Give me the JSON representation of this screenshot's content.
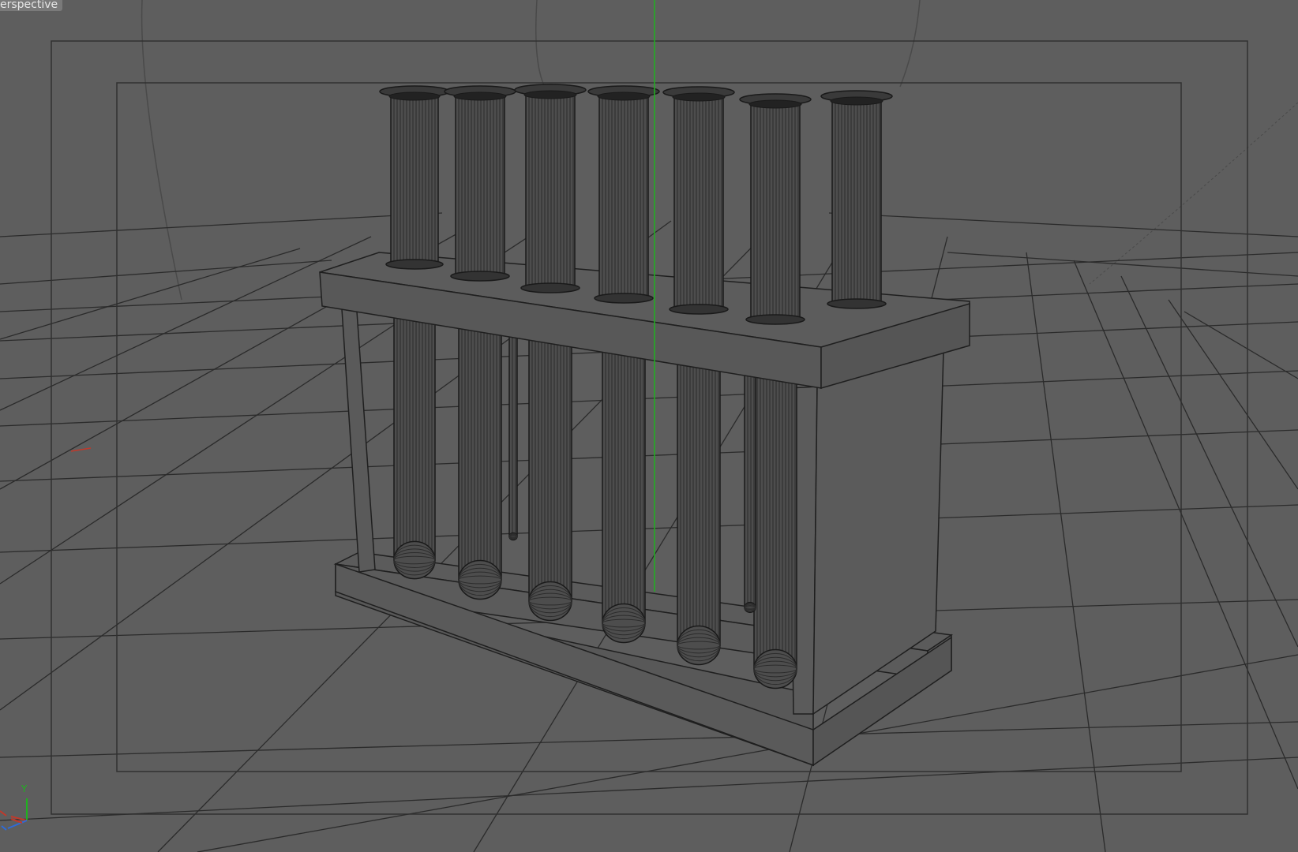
{
  "viewport": {
    "view_name": "erspective",
    "colors": {
      "background": "#5e5e5e",
      "grid": "#2a2a2a",
      "wire": "#1f1f1f",
      "tube_fill": "#4a4a4a",
      "rack_fill": "#5b5b5b",
      "y_axis": "#1fb21f",
      "x_axis": "#c0392b",
      "z_axis": "#2f6bd8"
    }
  },
  "axis_gizmo": {
    "y_label": "Y"
  },
  "scene": {
    "object": "test-tube-rack",
    "tube_count": 8
  }
}
